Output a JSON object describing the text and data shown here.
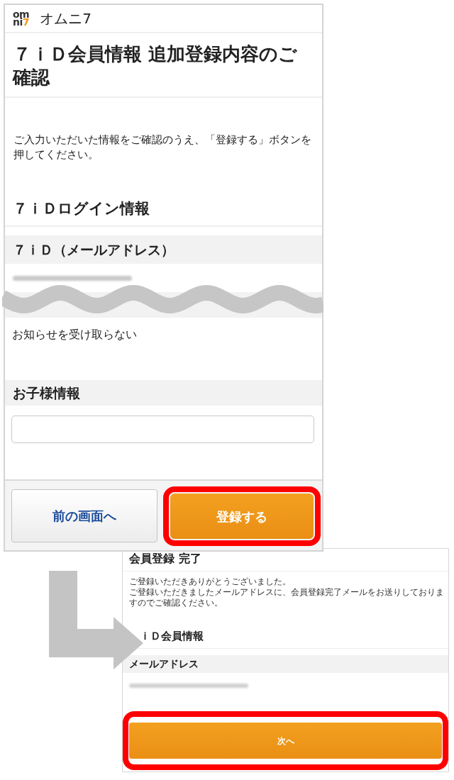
{
  "confirm_screen": {
    "header": {
      "logo": {
        "top": "om",
        "bottom": "ni",
        "accent": "7"
      },
      "site_name": "オムニ7"
    },
    "title": "７ｉＤ会員情報 追加登録内容のご確認",
    "message": "ご入力いただいた情報をご確認のうえ、「登録する」ボタンを押してください。",
    "items": [
      {
        "kind": "heading",
        "text": "７ｉＤログイン情報"
      },
      {
        "kind": "label",
        "text": "７ｉＤ（メールアドレス）"
      },
      {
        "kind": "blurred"
      },
      {
        "kind": "cut"
      },
      {
        "kind": "value",
        "text": "お知らせを受け取らない"
      },
      {
        "kind": "label",
        "text": "お子様情報"
      },
      {
        "kind": "input"
      }
    ],
    "buttons": [
      {
        "label": "前の画面へ",
        "kind": "secondary",
        "highlighted": false
      },
      {
        "label": "登録する",
        "kind": "primary",
        "highlighted": true
      }
    ]
  },
  "complete_screen": {
    "title": "会員登録 完了",
    "message_lines": [
      "ご登録いただきありがとうございました。",
      "ご登録いただきましたメールアドレスに、会員登録完了メールをお送りしておりますのでご確認ください。"
    ],
    "items": [
      {
        "kind": "heading",
        "text": "ｉＤ会員情報"
      },
      {
        "kind": "label",
        "text": "メールアドレス"
      },
      {
        "kind": "blurred"
      }
    ],
    "buttons": [
      {
        "label": "次へ",
        "kind": "primary",
        "highlighted": true
      }
    ]
  }
}
